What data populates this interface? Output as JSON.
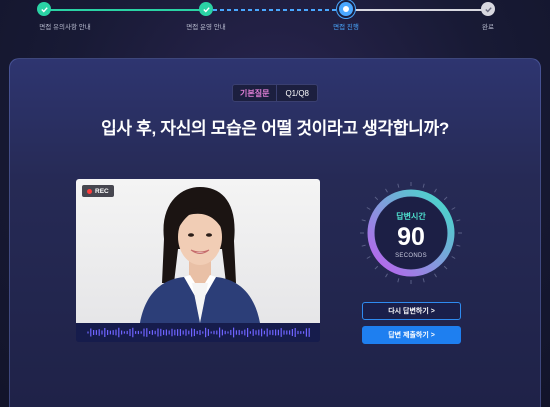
{
  "stepper": {
    "steps": [
      {
        "label": "면접 유의사항 안내",
        "state": "done"
      },
      {
        "label": "면접 운영 안내",
        "state": "done"
      },
      {
        "label": "면접 진행",
        "state": "current"
      },
      {
        "label": "완료",
        "state": "pending"
      }
    ],
    "colors": {
      "done": "#2ad3a5",
      "current": "#4aa8ff",
      "pending": "#d8d8e0"
    }
  },
  "question_card": {
    "category": "기본질문",
    "number": "Q1/Q8",
    "question": "입사 후, 자신의 모습은 어떨 것이라고 생각합니까?"
  },
  "video": {
    "rec_label": "REC"
  },
  "timer": {
    "label": "답변시간",
    "value": "90",
    "unit": "SECONDS",
    "gradient": [
      "#3fe0c8",
      "#c05cf0"
    ]
  },
  "actions": {
    "retry_label": "다시 답변하기 >",
    "submit_label": "답변 제출하기 >"
  }
}
